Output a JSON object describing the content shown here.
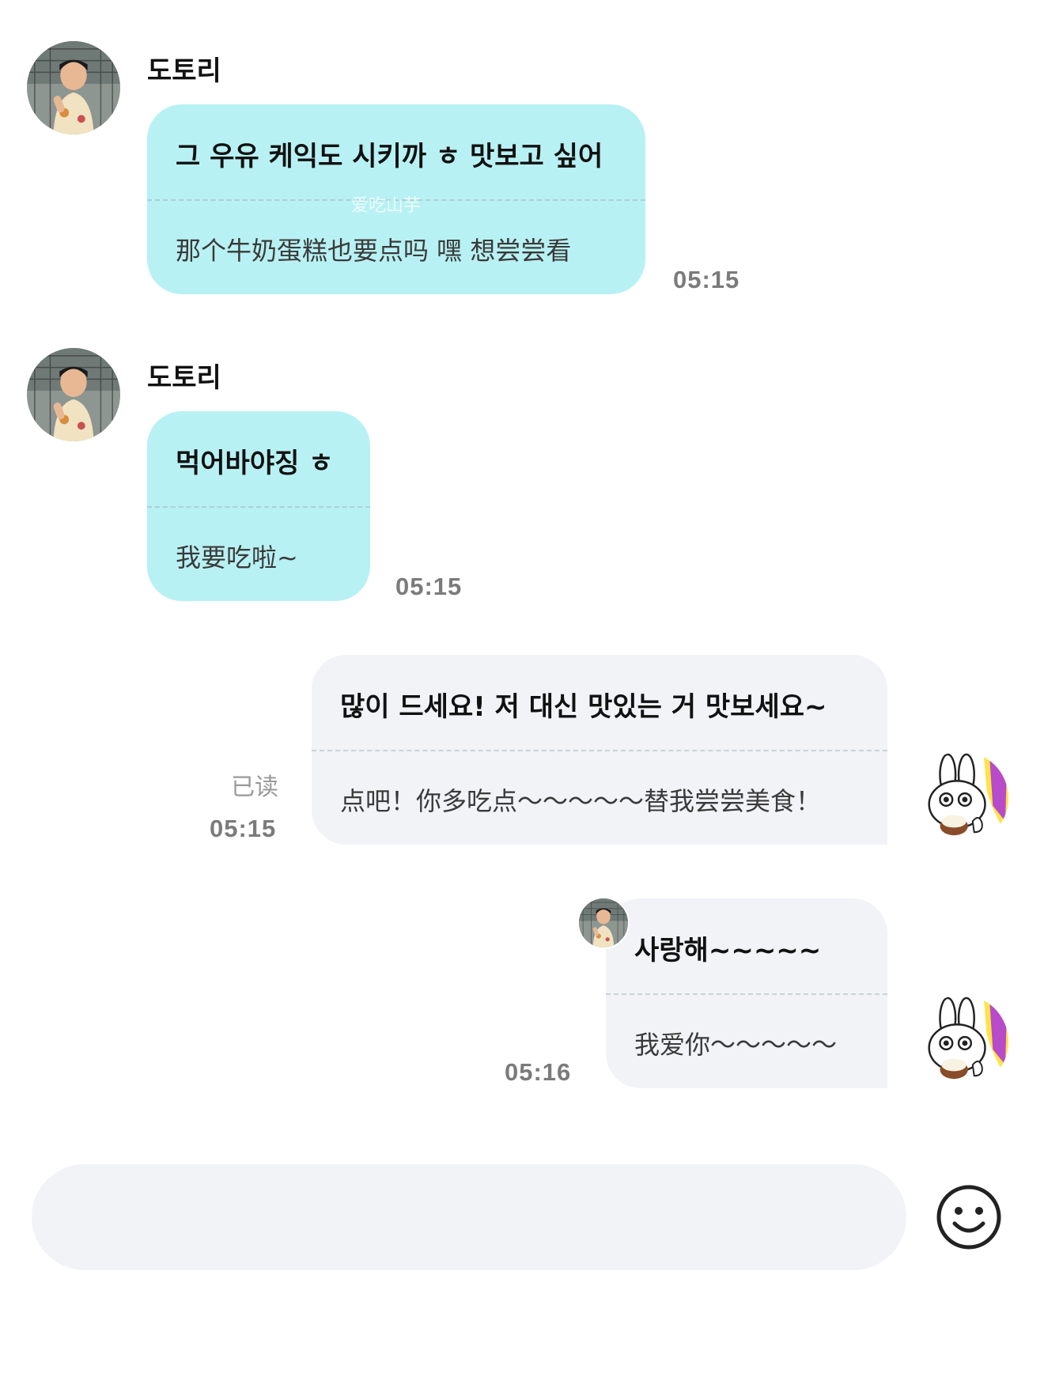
{
  "messages": [
    {
      "direction": "incoming",
      "sender": "도토리",
      "text_ko": "그 우유 케익도 시키까 ㅎ 맛보고 싶어",
      "text_zh": "那个牛奶蛋糕也要点吗 嘿 想尝尝看",
      "time": "05:15"
    },
    {
      "direction": "incoming",
      "sender": "도토리",
      "text_ko": "먹어바야징 ㅎ",
      "text_zh": "我要吃啦~",
      "time": "05:15"
    },
    {
      "direction": "outgoing",
      "text_ko": "많이 드세요! 저 대신 맛있는 거 맛보세요~",
      "text_zh": "点吧！你多吃点～～～～～替我尝尝美食！",
      "read_status": "已读",
      "time": "05:15"
    },
    {
      "direction": "outgoing",
      "text_ko": "사랑해~~~~~",
      "text_zh": "我爱你～～～～～",
      "time": "05:16"
    }
  ],
  "watermark": "爱吃山芋",
  "icons": {
    "emoji": "smiley-face-icon",
    "incoming_avatar": "child-photo-avatar",
    "outgoing_avatar": "bunny-sticker-avatar"
  },
  "colors": {
    "incoming_bubble": "#b8f1f3",
    "outgoing_bubble": "#f2f3f7",
    "time_text": "#7b7b7b",
    "input_bar": "#f2f3f7"
  }
}
